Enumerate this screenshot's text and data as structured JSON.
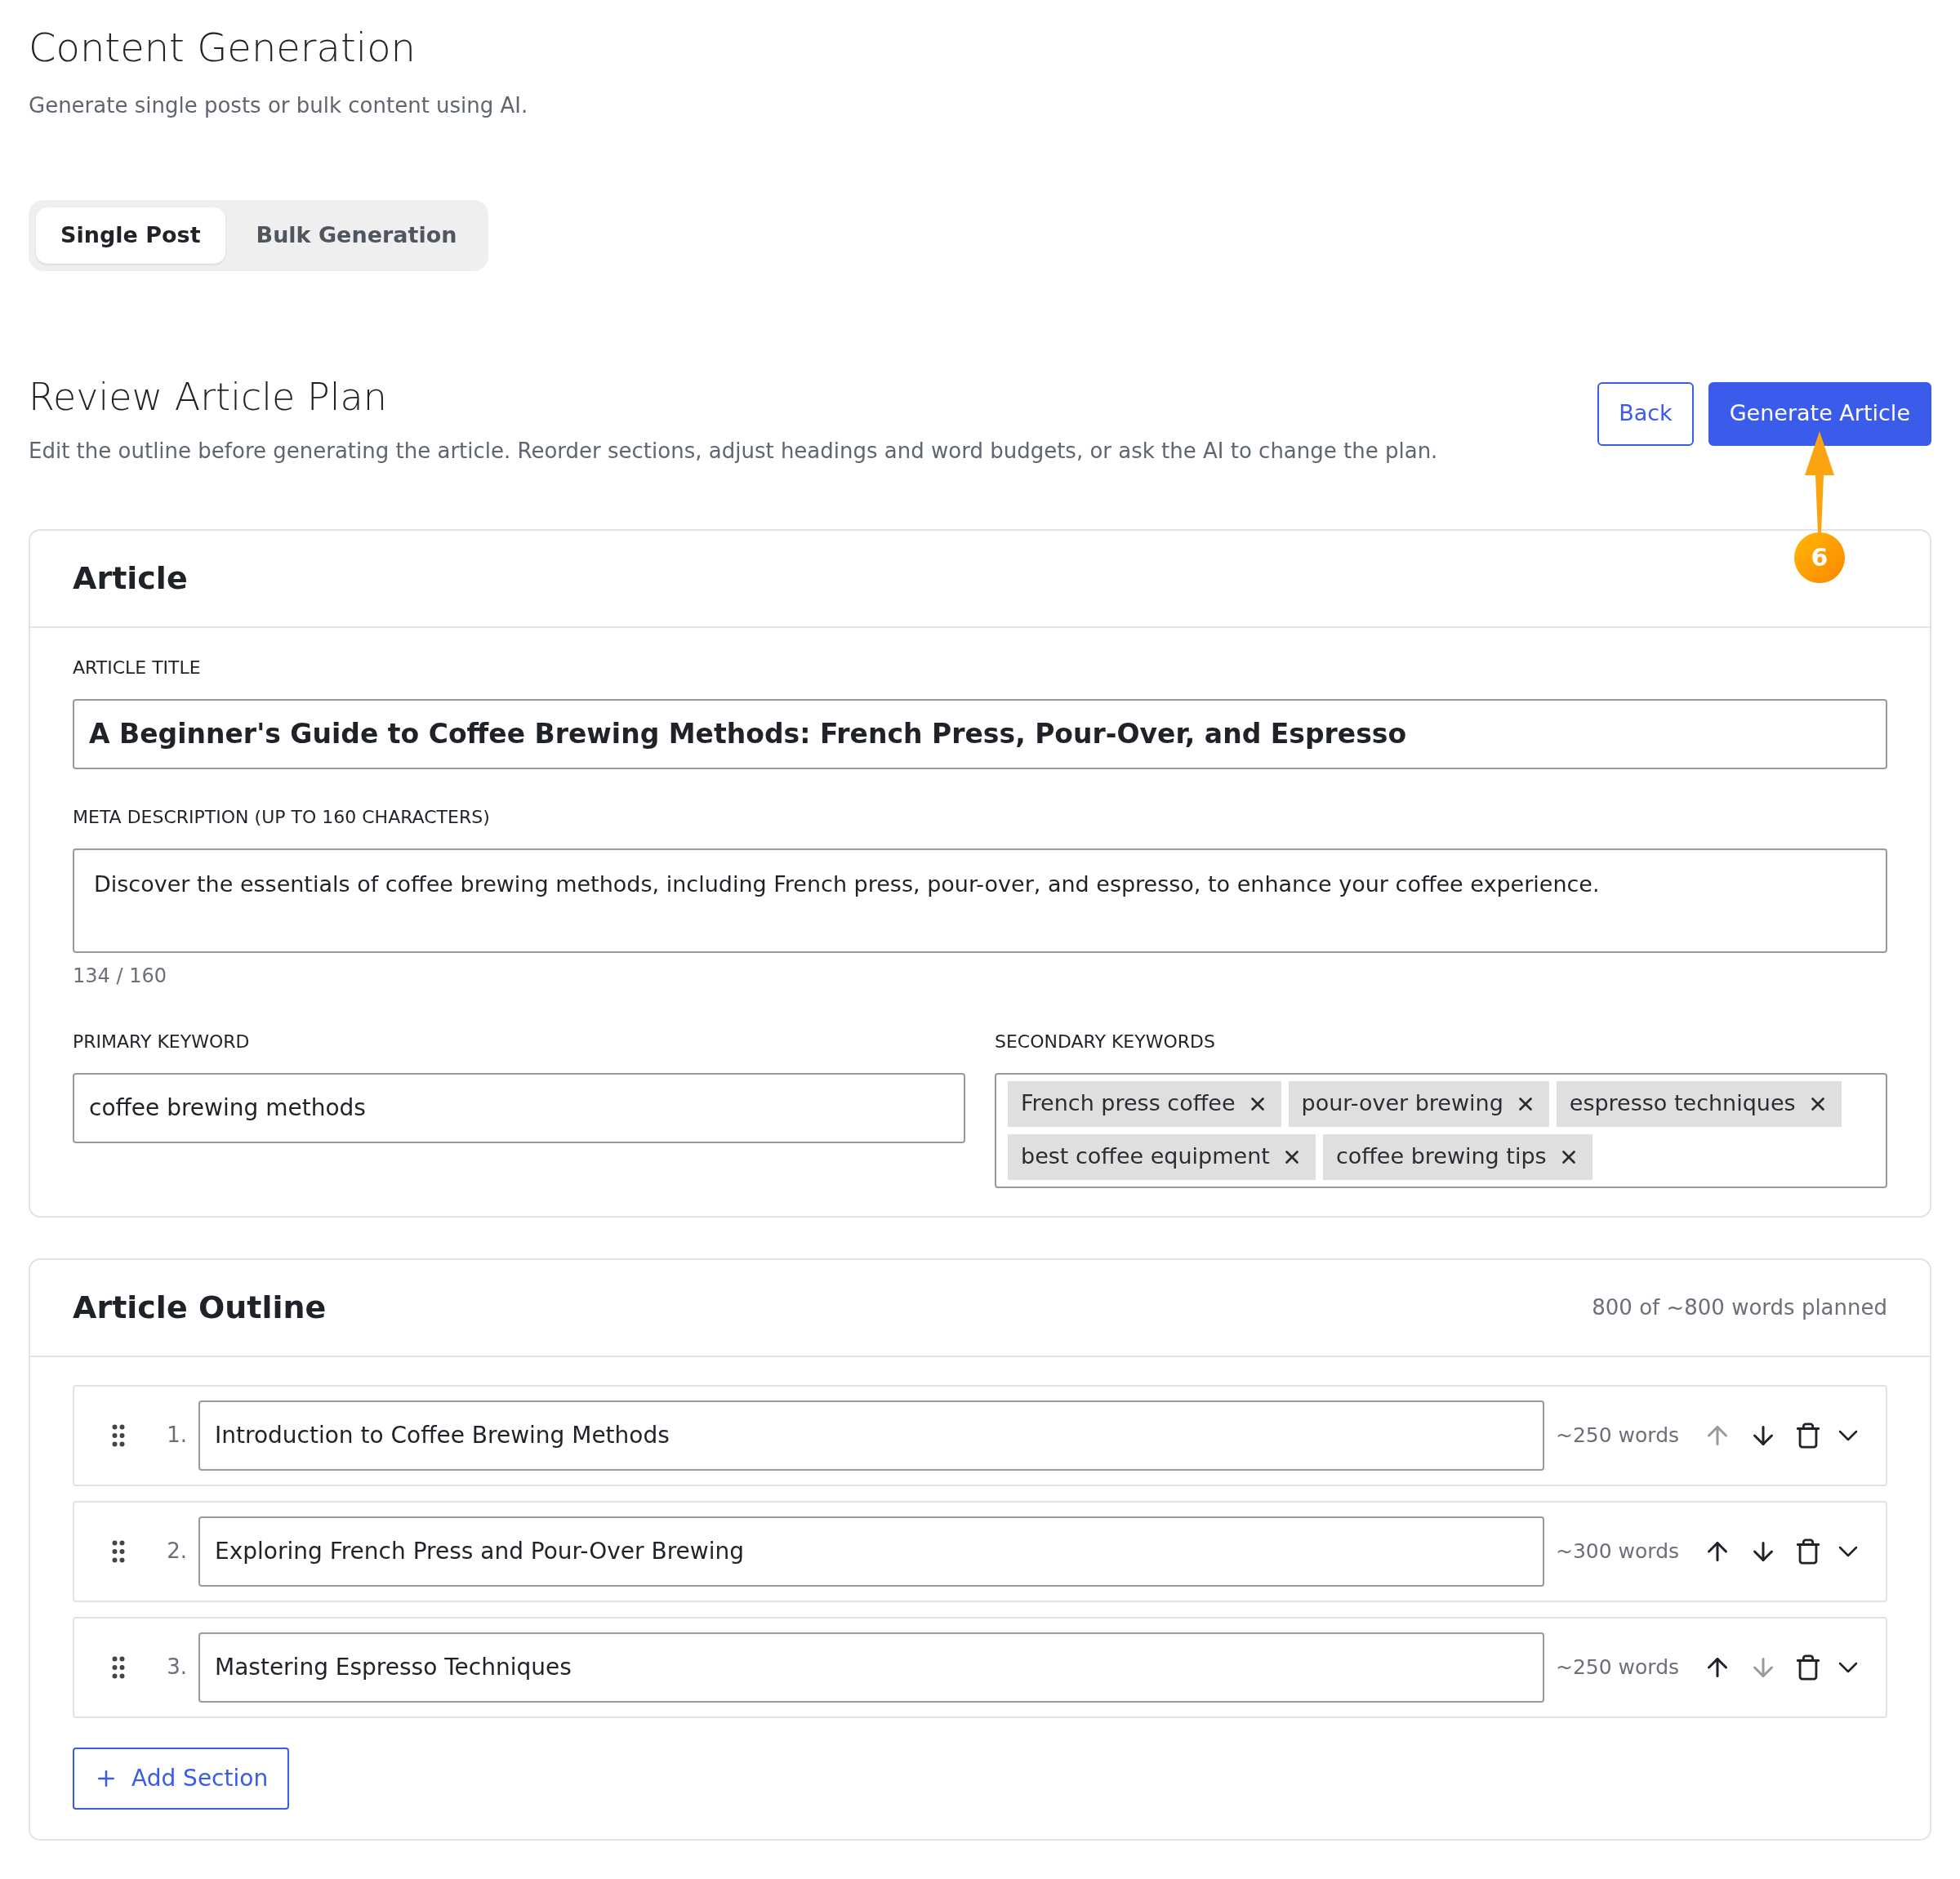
{
  "page": {
    "title": "Content Generation",
    "subtitle": "Generate single posts or bulk content using AI."
  },
  "tabs": [
    {
      "label": "Single Post",
      "selected": true
    },
    {
      "label": "Bulk Generation",
      "selected": false
    }
  ],
  "plan": {
    "title": "Review Article Plan",
    "description": "Edit the outline before generating the article. Reorder sections, adjust headings and word budgets, or ask the AI to change the plan.",
    "buttons": [
      {
        "label": "Back",
        "kind": "secondary"
      },
      {
        "label": "Generate Article",
        "kind": "primary"
      }
    ]
  },
  "annotation": {
    "label": "6"
  },
  "article": {
    "heading": "Article",
    "title_label": "ARTICLE TITLE",
    "title_value": "A Beginner's Guide to Coffee Brewing Methods: French Press, Pour-Over, and Espresso",
    "meta_label": "META DESCRIPTION (UP TO 160 CHARACTERS)",
    "meta_value": "Discover the essentials of coffee brewing methods, including French press, pour-over, and espresso, to enhance your coffee experience.",
    "meta_count": "134 / 160",
    "primary_label": "PRIMARY KEYWORD",
    "primary_value": "coffee brewing methods",
    "secondary_label": "SECONDARY KEYWORDS",
    "secondary_keywords": [
      "French press coffee",
      "pour-over brewing",
      "espresso techniques",
      "best coffee equipment",
      "coffee brewing tips"
    ]
  },
  "outline": {
    "heading": "Article Outline",
    "summary": "800 of ~800 words planned",
    "sections": [
      {
        "number": "1.",
        "heading": "Introduction to Coffee Brewing Methods",
        "words": "~250 words",
        "up_disabled": true,
        "down_disabled": false
      },
      {
        "number": "2.",
        "heading": "Exploring French Press and Pour-Over Brewing",
        "words": "~300 words",
        "up_disabled": false,
        "down_disabled": false
      },
      {
        "number": "3.",
        "heading": "Mastering Espresso Techniques",
        "words": "~250 words",
        "up_disabled": false,
        "down_disabled": true
      }
    ],
    "add_button": "Add Section"
  }
}
